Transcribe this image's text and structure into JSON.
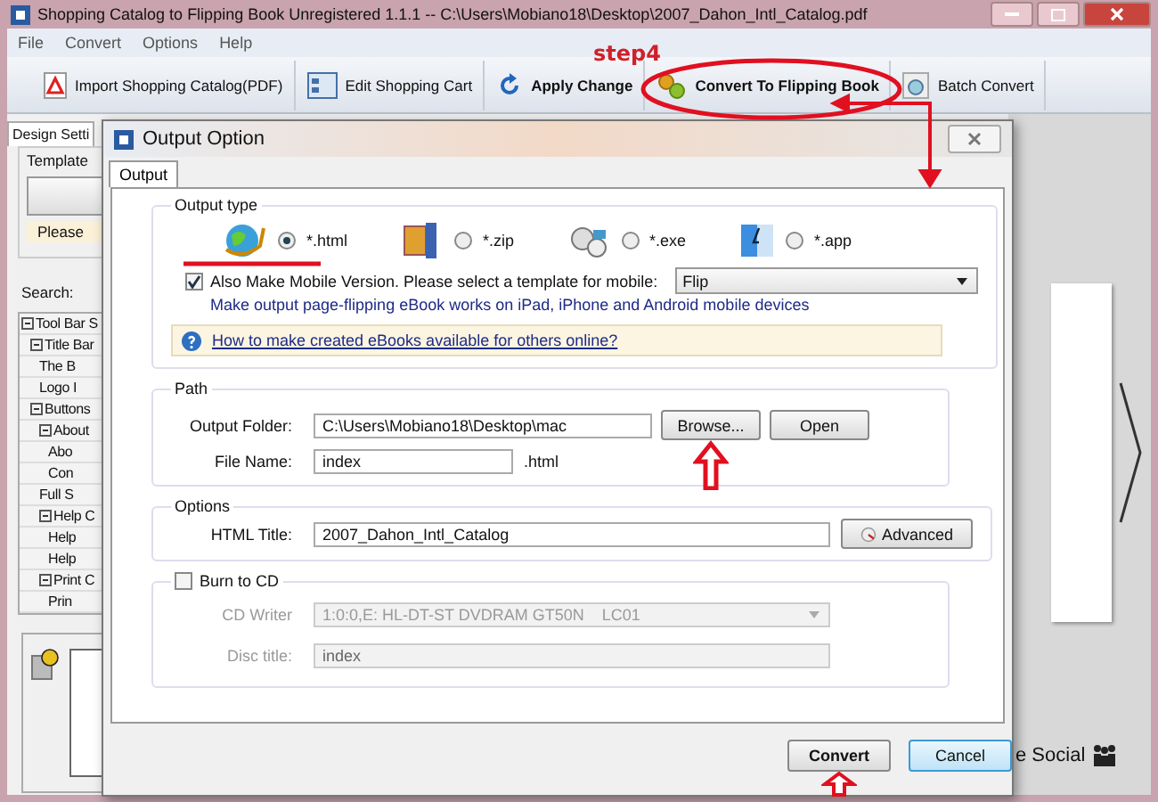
{
  "window": {
    "title": "Shopping Catalog to Flipping Book Unregistered 1.1.1  -- C:\\Users\\Mobiano18\\Desktop\\2007_Dahon_Intl_Catalog.pdf"
  },
  "menu": [
    "File",
    "Convert",
    "Options",
    "Help"
  ],
  "toolbar": [
    {
      "label": "Import Shopping Catalog(PDF)",
      "kind": "import",
      "bold": false
    },
    {
      "label": "Edit Shopping Cart",
      "kind": "cart",
      "bold": false
    },
    {
      "label": "Apply Change",
      "kind": "apply",
      "bold": true
    },
    {
      "label": "Convert To Flipping Book",
      "kind": "convert",
      "bold": true
    },
    {
      "label": "Batch Convert",
      "kind": "batch",
      "bold": false
    }
  ],
  "annotation": {
    "label": "step4"
  },
  "left_panel": {
    "tab": "Design Setti",
    "group": "Template",
    "notice": "Please",
    "search_label": "Search:",
    "tree": [
      {
        "label": "Tool Bar S",
        "expanded": true,
        "children": [
          {
            "label": "Title Bar",
            "expanded": true,
            "children": [
              {
                "label": "The B"
              },
              {
                "label": "Logo I"
              }
            ]
          },
          {
            "label": "Buttons",
            "expanded": true,
            "children": [
              {
                "label": "About",
                "expanded": true,
                "children": [
                  {
                    "label": "Abo"
                  },
                  {
                    "label": "Con"
                  }
                ]
              },
              {
                "label": "Full S"
              },
              {
                "label": "Help C",
                "expanded": true,
                "children": [
                  {
                    "label": "Help"
                  },
                  {
                    "label": "Help"
                  }
                ]
              },
              {
                "label": "Print C",
                "expanded": true,
                "children": [
                  {
                    "label": "Prin"
                  }
                ]
              }
            ]
          }
        ]
      }
    ]
  },
  "preview": {
    "footer": "e Social"
  },
  "dialog": {
    "title": "Output Option",
    "tabs": [
      {
        "label": "Output",
        "selected": true
      }
    ],
    "output_type": {
      "title": "Output type",
      "options": [
        {
          "label": "*.html",
          "kind": "html",
          "selected": true
        },
        {
          "label": "*.zip",
          "kind": "zip",
          "selected": false
        },
        {
          "label": "*.exe",
          "kind": "exe",
          "selected": false
        },
        {
          "label": "*.app",
          "kind": "app",
          "selected": false
        }
      ],
      "mobile": {
        "label": "Also Make Mobile Version. Please select a template for mobile:",
        "checked": true,
        "template": "Flip",
        "note": "Make output page-flipping eBook works on iPad, iPhone and Android mobile devices"
      },
      "help_link": "How to make created eBooks available for others online?"
    },
    "path": {
      "title": "Path",
      "folder_label": "Output Folder:",
      "folder": "C:\\Users\\Mobiano18\\Desktop\\mac",
      "browse": "Browse...",
      "open": "Open",
      "file_label": "File Name:",
      "file": "index",
      "extension": ".html"
    },
    "options": {
      "title": "Options",
      "html_title_label": "HTML Title:",
      "html_title": "2007_Dahon_Intl_Catalog",
      "advanced": "Advanced"
    },
    "burn": {
      "label": "Burn to CD",
      "checked": false,
      "writer_label": "CD Writer",
      "writer": "1:0:0,E: HL-DT-ST DVDRAM GT50N    LC01",
      "disc_label": "Disc title:",
      "disc": "index"
    },
    "buttons": [
      {
        "label": "Convert",
        "kind": "default"
      },
      {
        "label": "Cancel",
        "kind": "focused"
      }
    ]
  }
}
